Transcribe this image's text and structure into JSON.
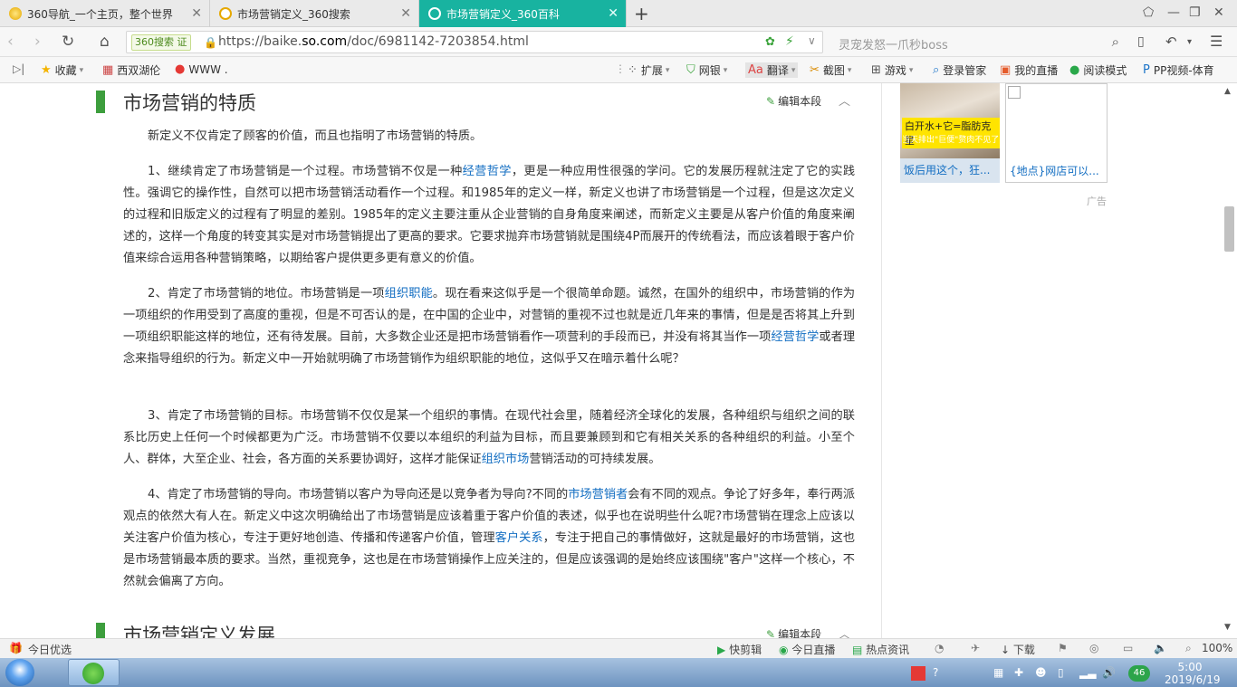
{
  "tabs": [
    {
      "title": "360导航_一个主页，整个世界",
      "active": false
    },
    {
      "title": "市场营销定义_360搜索",
      "active": false
    },
    {
      "title": "市场营销定义_360百科",
      "active": true
    }
  ],
  "address": {
    "badge": "360搜索 证",
    "url_prefix": "https://baike.",
    "url_domain": "so.com",
    "url_path": "/doc/6981142-7203854.html",
    "search_placeholder": "灵宠发怒一爪秒boss"
  },
  "bookmarks": {
    "left": [
      "收藏",
      "西双湖伦",
      "WWW ."
    ],
    "right": [
      "扩展",
      "网银",
      "翻译",
      "截图",
      "游戏",
      "登录管家",
      "我的直播",
      "阅读模式",
      "PP视频-体育"
    ]
  },
  "article": {
    "section1_title": "市场营销的特质",
    "edit_label": "编辑本段",
    "intro": "新定义不仅肯定了顾客的价值，而且也指明了市场营销的特质。",
    "p1": {
      "a": "1、继续肯定了市场营销是一个过程。市场营销不仅是一种",
      "link1": "经营哲学",
      "b": "，更是一种应用性很强的学问。它的发展历程就注定了它的实践性。强调它的操作性，自然可以把市场营销活动看作一个过程。和1985年的定义一样，新定义也讲了市场营销是一个过程，但是这次定义的过程和旧版定义的过程有了明显的差别。1985年的定义主要注重从企业营销的自身角度来阐述，而新定义主要是从客户价值的角度来阐述的，这样一个角度的转变其实是对市场营销提出了更高的要求。它要求抛弃市场营销就是围绕4P而展开的传统看法，而应该着眼于客户价值来综合运用各种营销策略，以期给客户提供更多更有意义的价值。"
    },
    "p2": {
      "a": "2、肯定了市场营销的地位。市场营销是一项",
      "link1": "组织职能",
      "b": "。现在看来这似乎是一个很简单命题。诚然，在国外的组织中，市场营销的作为一项组织的作用受到了高度的重视，但是不可否认的是，在中国的企业中，对营销的重视不过也就是近几年来的事情，但是是否将其上升到一项组织职能这样的地位，还有待发展。目前，大多数企业还是把市场营销看作一项营利的手段而已，并没有将其当作一项",
      "link2": "经营哲学",
      "c": "或者理念来指导组织的行为。新定义中一开始就明确了市场营销作为组织职能的地位，这似乎又在暗示着什么呢？"
    },
    "p3": {
      "a": "3、肯定了市场营销的目标。市场营销不仅仅是某一个组织的事情。在现代社会里，随着经济全球化的发展，各种组织与组织之间的联系比历史上任何一个时候都更为广泛。市场营销不仅要以本组织的利益为目标，而且要兼顾到和它有相关关系的各种组织的利益。小至个人、群体，大至企业、社会，各方面的关系要协调好，这样才能保证",
      "link1": "组织市场",
      "b": "营销活动的可持续发展。"
    },
    "p4": {
      "a": "4、肯定了市场营销的导向。市场营销以客户为导向还是以竞争者为导向?不同的",
      "link1": "市场营销者",
      "b": "会有不同的观点。争论了好多年，奉行两派观点的依然大有人在。新定义中这次明确给出了市场营销是应该着重于客户价值的表述，似乎也在说明些什么呢?市场营销在理念上应该以关注客户价值为核心，专注于更好地创造、传播和传递客户价值，管理",
      "link2": "客户关系",
      "c": "，专注于把自己的事情做好，这就是最好的市场营销，这也是市场营销最本质的要求。当然，重视竞争，这也是在市场营销操作上应关注的，但是应该强调的是始终应该围绕\"客户\"这样一个核心，不然就会偏离了方向。"
    },
    "section2_title": "市场营销定义发展"
  },
  "ads": {
    "ad1_tag": "白开水+它=脂肪克星",
    "ad1_sub": "当天排出\"巨便\"赘肉不见了",
    "ad1_caption": "饭后用这个，狂...",
    "ad2_caption": "{地点}网店可以...",
    "label": "广告"
  },
  "statusbar": {
    "left": "今日优选",
    "items": [
      "快剪辑",
      "今日直播",
      "热点资讯",
      "下载"
    ],
    "zoom": "100%"
  },
  "taskbar": {
    "time": "5:00",
    "date": "2019/6/19",
    "net_badge": "46"
  }
}
